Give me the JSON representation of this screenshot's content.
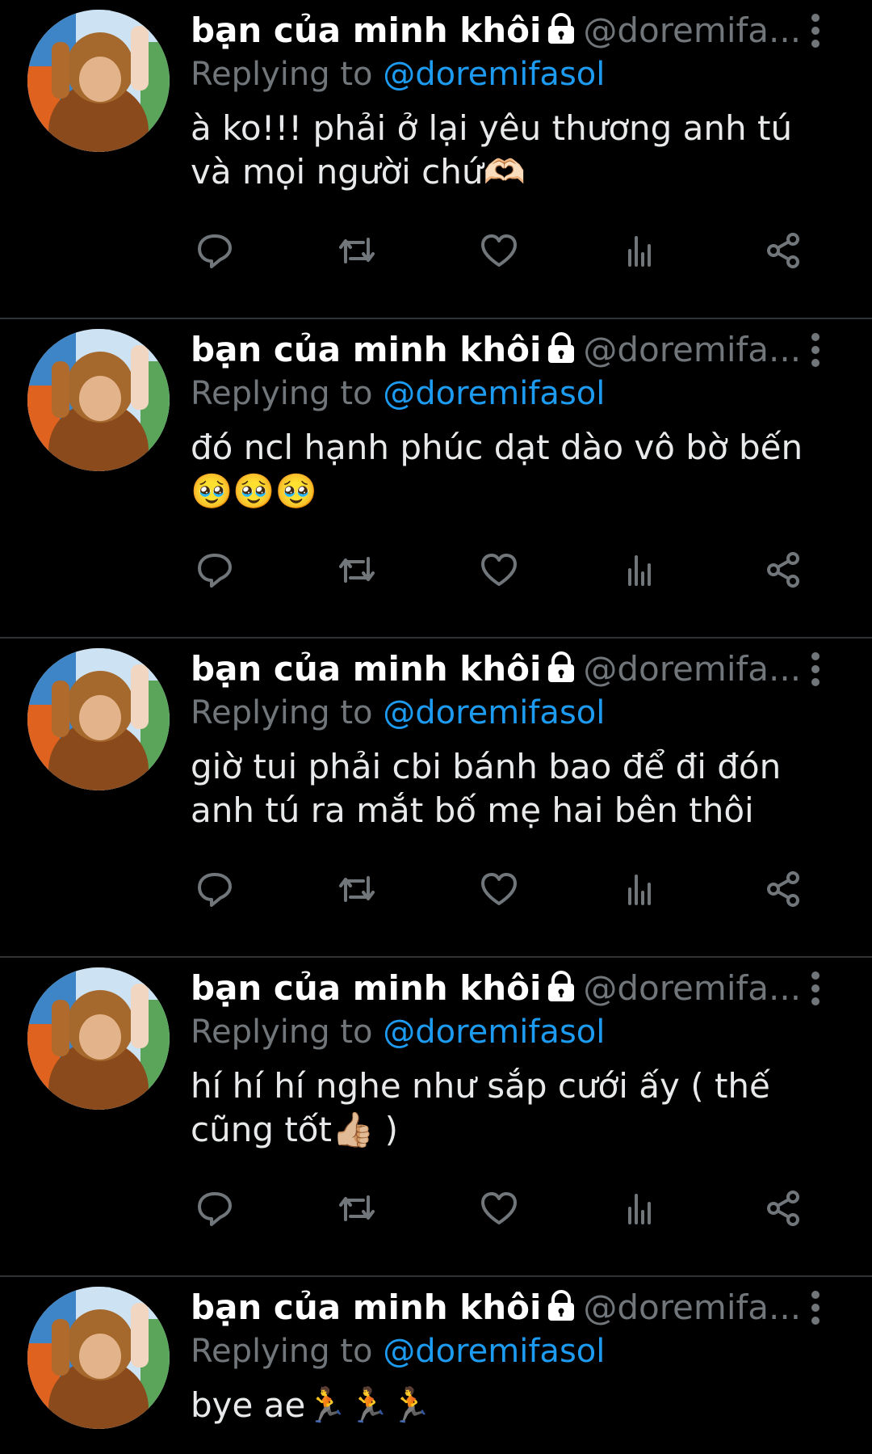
{
  "tweets": [
    {
      "name": "bạn của minh khôi",
      "handle": "@doremifa...",
      "replying_prefix": "Replying to",
      "replying_to": "@doremifasol",
      "text": "à ko!!! phải ở lại yêu thương anh tú và mọi người chứ🫶🏻"
    },
    {
      "name": "bạn của minh khôi",
      "handle": "@doremifa...",
      "replying_prefix": "Replying to",
      "replying_to": "@doremifasol",
      "text": "đó ncl hạnh phúc dạt dào vô bờ bến 🥹🥹🥹"
    },
    {
      "name": "bạn của minh khôi",
      "handle": "@doremifa...",
      "replying_prefix": "Replying to",
      "replying_to": "@doremifasol",
      "text": "giờ tui phải cbi bánh bao để đi đón anh tú ra mắt bố mẹ hai bên thôi"
    },
    {
      "name": "bạn của minh khôi",
      "handle": "@doremifa...",
      "replying_prefix": "Replying to",
      "replying_to": "@doremifasol",
      "text": "hí hí hí nghe như sắp cưới ấy ( thế cũng tốt👍🏼 )"
    },
    {
      "name": "bạn của minh khôi",
      "handle": "@doremifa...",
      "replying_prefix": "Replying to",
      "replying_to": "@doremifasol",
      "text": "bye ae🏃🏃🏃"
    }
  ],
  "icons": {
    "lock": "lock-icon",
    "more": "more-vertical-icon",
    "reply": "reply-icon",
    "retweet": "retweet-icon",
    "like": "heart-icon",
    "views": "views-icon",
    "share": "share-icon"
  },
  "colors": {
    "background": "#000000",
    "text": "#e7e9ea",
    "muted": "#71767b",
    "link": "#1d9bf0",
    "divider": "#2f3336"
  }
}
